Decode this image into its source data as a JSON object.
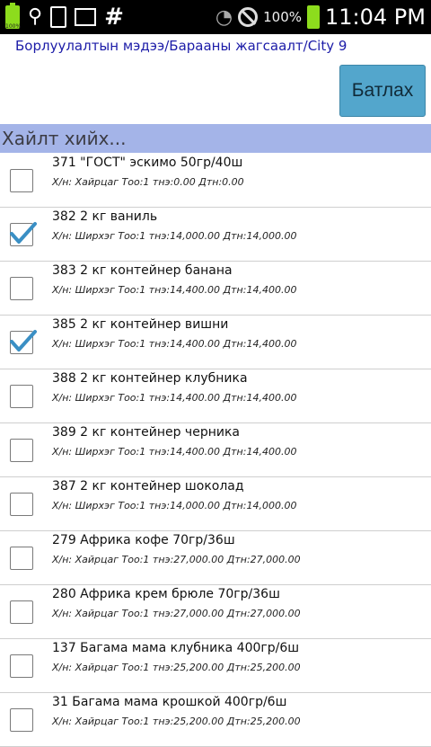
{
  "status_bar": {
    "battery_small_label": "100%",
    "battery_percent": "100%",
    "time": "11:04 PM"
  },
  "app": {
    "title": "Борлуулалтын мэдээ/Барааны жагсаалт/City 9",
    "confirm_button": "Батлах",
    "search_placeholder": "Хайлт хийх..."
  },
  "items": [
    {
      "name": "371 \"ГОСТ\" эскимо 50гр/40ш",
      "detail": "Х/н: Хайрцаг Тоо:1 тнэ:0.00 Дтн:0.00",
      "checked": false
    },
    {
      "name": "382 2 кг ваниль",
      "detail": "Х/н: Ширхэг Тоо:1 тнэ:14,000.00 Дтн:14,000.00",
      "checked": true
    },
    {
      "name": "383 2 кг контейнер банана",
      "detail": "Х/н: Ширхэг Тоо:1 тнэ:14,400.00 Дтн:14,400.00",
      "checked": false
    },
    {
      "name": "385 2 кг контейнер вишни",
      "detail": "Х/н: Ширхэг Тоо:1 тнэ:14,400.00 Дтн:14,400.00",
      "checked": true
    },
    {
      "name": "388 2 кг контейнер клубника",
      "detail": "Х/н: Ширхэг Тоо:1 тнэ:14,400.00 Дтн:14,400.00",
      "checked": false
    },
    {
      "name": "389 2 кг контейнер черника",
      "detail": "Х/н: Ширхэг Тоо:1 тнэ:14,400.00 Дтн:14,400.00",
      "checked": false
    },
    {
      "name": "387 2 кг контейнер шоколад",
      "detail": "Х/н: Ширхэг Тоо:1 тнэ:14,000.00 Дтн:14,000.00",
      "checked": false
    },
    {
      "name": "279 Африка кофе 70гр/36ш",
      "detail": "Х/н: Хайрцаг Тоо:1 тнэ:27,000.00 Дтн:27,000.00",
      "checked": false
    },
    {
      "name": "280 Африка крем брюле 70гр/36ш",
      "detail": "Х/н: Хайрцаг Тоо:1 тнэ:27,000.00 Дтн:27,000.00",
      "checked": false
    },
    {
      "name": "137 Багама мама клубника 400гр/6ш",
      "detail": "Х/н: Хайрцаг Тоо:1 тнэ:25,200.00 Дтн:25,200.00",
      "checked": false
    },
    {
      "name": "31 Багама мама крошкой 400гр/6ш",
      "detail": "Х/н: Хайрцаг Тоо:1 тнэ:25,200.00 Дтн:25,200.00",
      "checked": false
    }
  ]
}
